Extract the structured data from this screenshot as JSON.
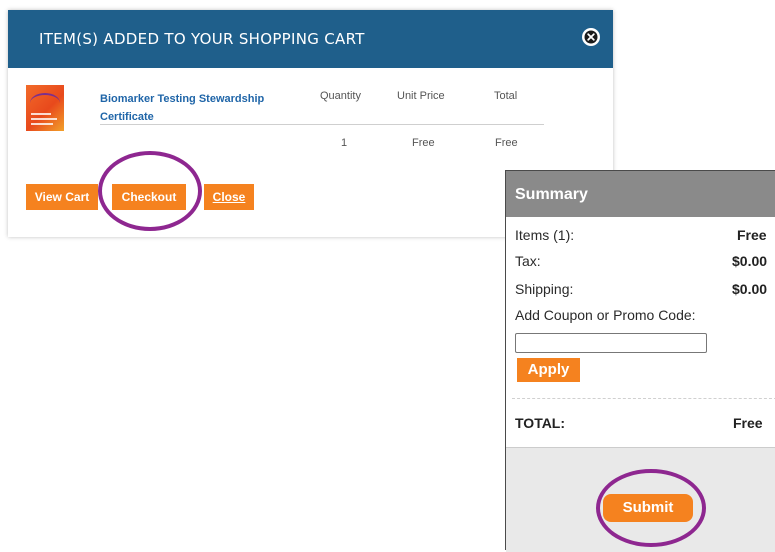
{
  "cart_modal": {
    "title": "ITEM(S) ADDED TO YOUR SHOPPING CART",
    "close_icon": "close-circle-icon",
    "product": {
      "name": "Biomarker Testing Stewardship Certificate",
      "quantity": "1",
      "unit_price": "Free",
      "total": "Free"
    },
    "columns": {
      "quantity": "Quantity",
      "unit_price": "Unit Price",
      "total": "Total"
    },
    "buttons": {
      "view_cart": "View Cart",
      "checkout": "Checkout",
      "close": "Close"
    }
  },
  "summary": {
    "title": "Summary",
    "items_label": "Items (1):",
    "items_value": "Free",
    "tax_label": "Tax:",
    "tax_value": "$0.00",
    "shipping_label": "Shipping:",
    "shipping_value": "$0.00",
    "promo_label": "Add Coupon or Promo Code:",
    "promo_value": "",
    "apply_label": "Apply",
    "total_label": "TOTAL:",
    "total_value": "Free",
    "submit_label": "Submit"
  },
  "colors": {
    "header_blue": "#1f5f8b",
    "button_orange": "#f5821f",
    "highlight_purple": "#8e2790",
    "summary_header_gray": "#8a8a8a"
  }
}
